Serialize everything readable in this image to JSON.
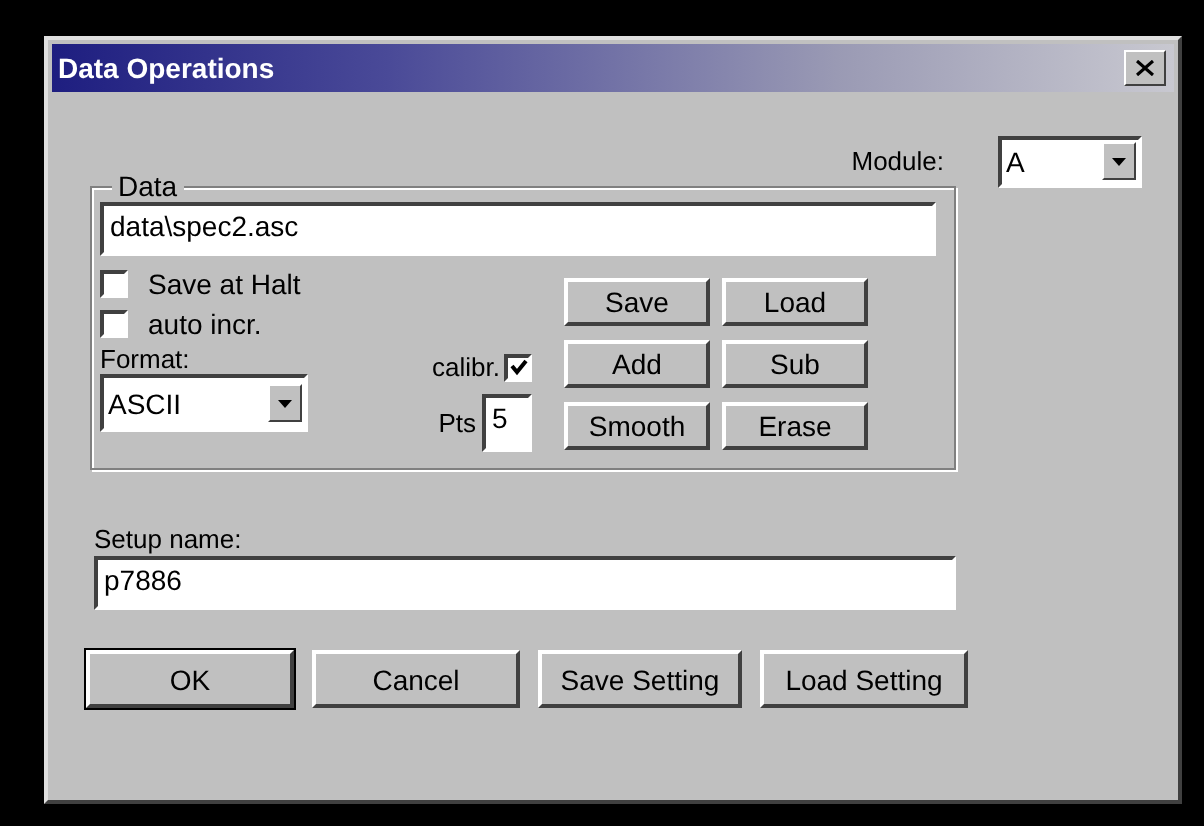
{
  "window": {
    "title": "Data Operations"
  },
  "module": {
    "label": "Module:",
    "value": "A"
  },
  "data_group": {
    "title": "Data",
    "path": "data\\spec2.asc",
    "checkboxes": [
      {
        "label": "Save at Halt",
        "checked": false
      },
      {
        "label": "auto incr.",
        "checked": false
      }
    ],
    "format": {
      "label": "Format:",
      "value": "ASCII"
    },
    "calibr": {
      "label": "calibr.",
      "checked": true
    },
    "pts": {
      "label": "Pts",
      "value": "5"
    },
    "buttons": [
      "Save",
      "Load",
      "Add",
      "Sub",
      "Smooth",
      "Erase"
    ]
  },
  "setup": {
    "label": "Setup name:",
    "value": "p7886"
  },
  "buttons": [
    {
      "label": "OK",
      "default": true
    },
    {
      "label": "Cancel",
      "default": false
    },
    {
      "label": "Save Setting",
      "default": false
    },
    {
      "label": "Load Setting",
      "default": false
    }
  ]
}
